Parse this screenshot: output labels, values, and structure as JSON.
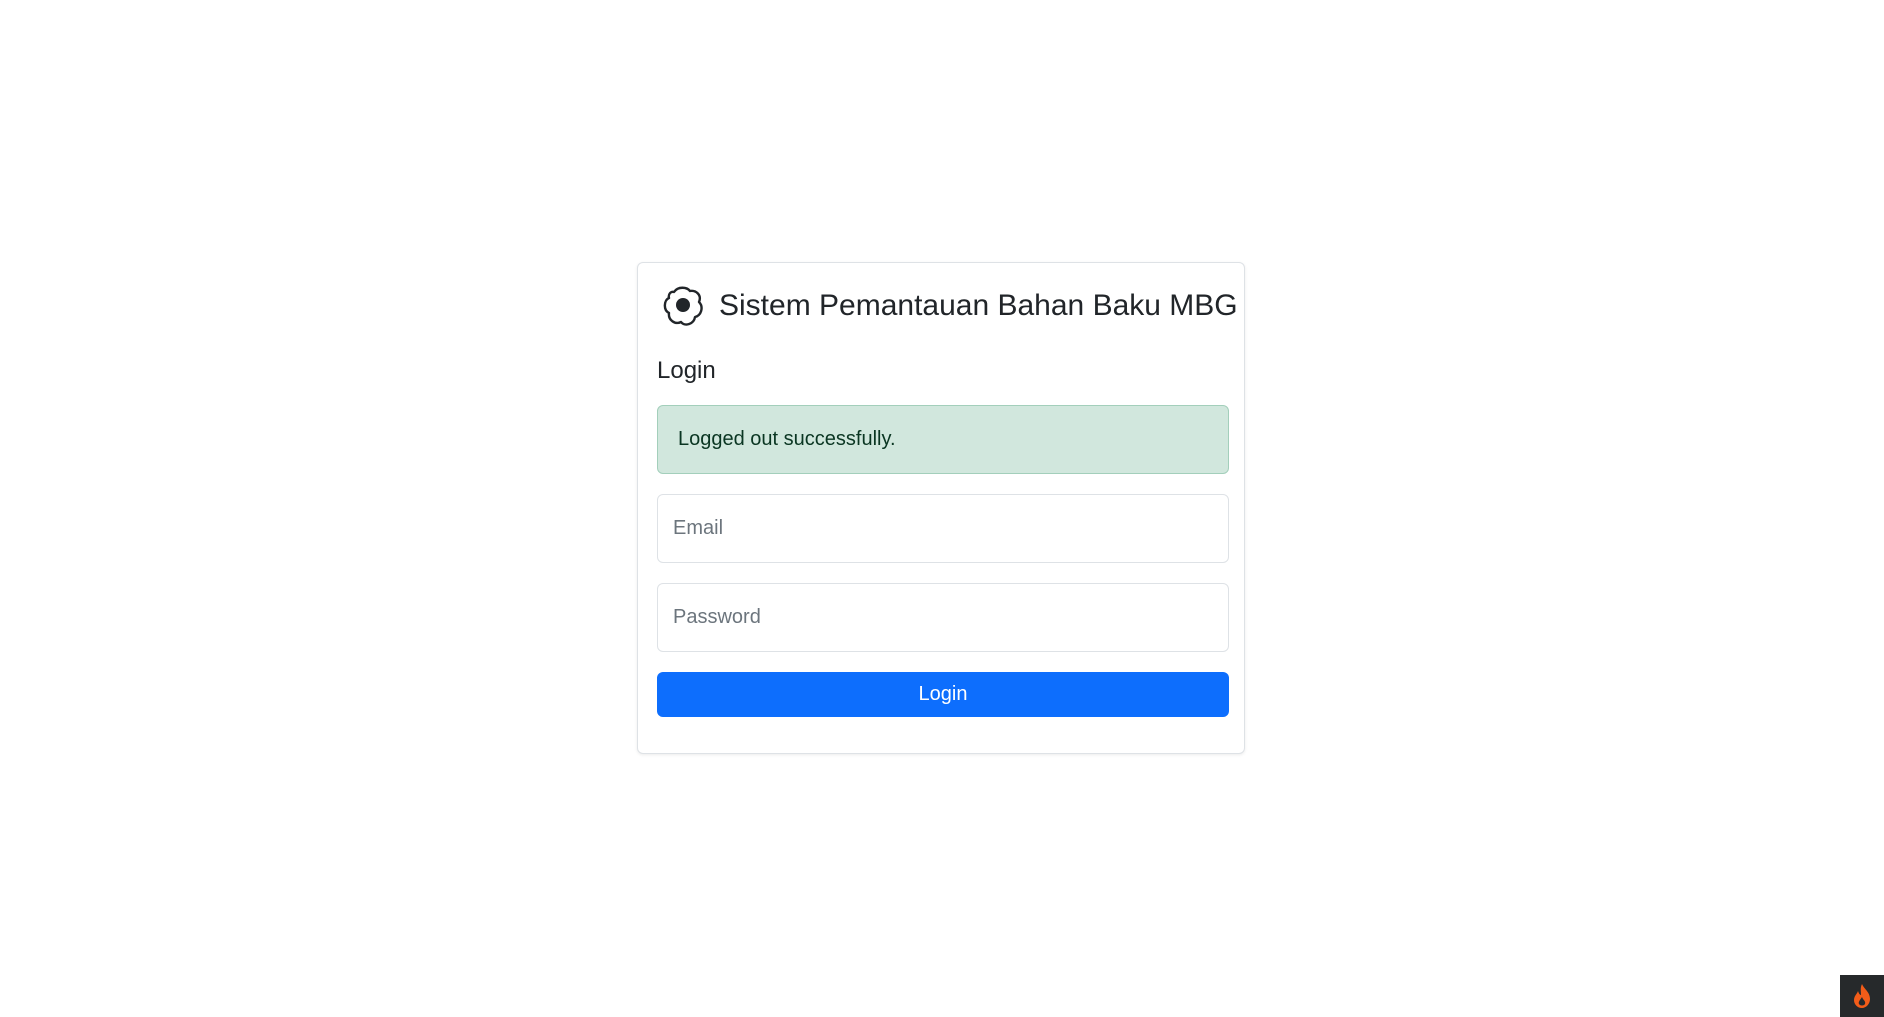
{
  "header": {
    "app_title": "Sistem Pemantauan Bahan Baku MBG",
    "logo_icon": "egg-fried-icon"
  },
  "login_form": {
    "heading": "Login",
    "alert": {
      "text": "Logged out successfully.",
      "type": "success",
      "background_color": "#d1e7dd"
    },
    "email": {
      "placeholder": "Email",
      "value": ""
    },
    "password": {
      "placeholder": "Password",
      "value": ""
    },
    "submit_label": "Login",
    "submit_color": "#0d6efd"
  },
  "corner_widget": {
    "icon": "flame-icon",
    "accent_color": "#f25c19"
  }
}
